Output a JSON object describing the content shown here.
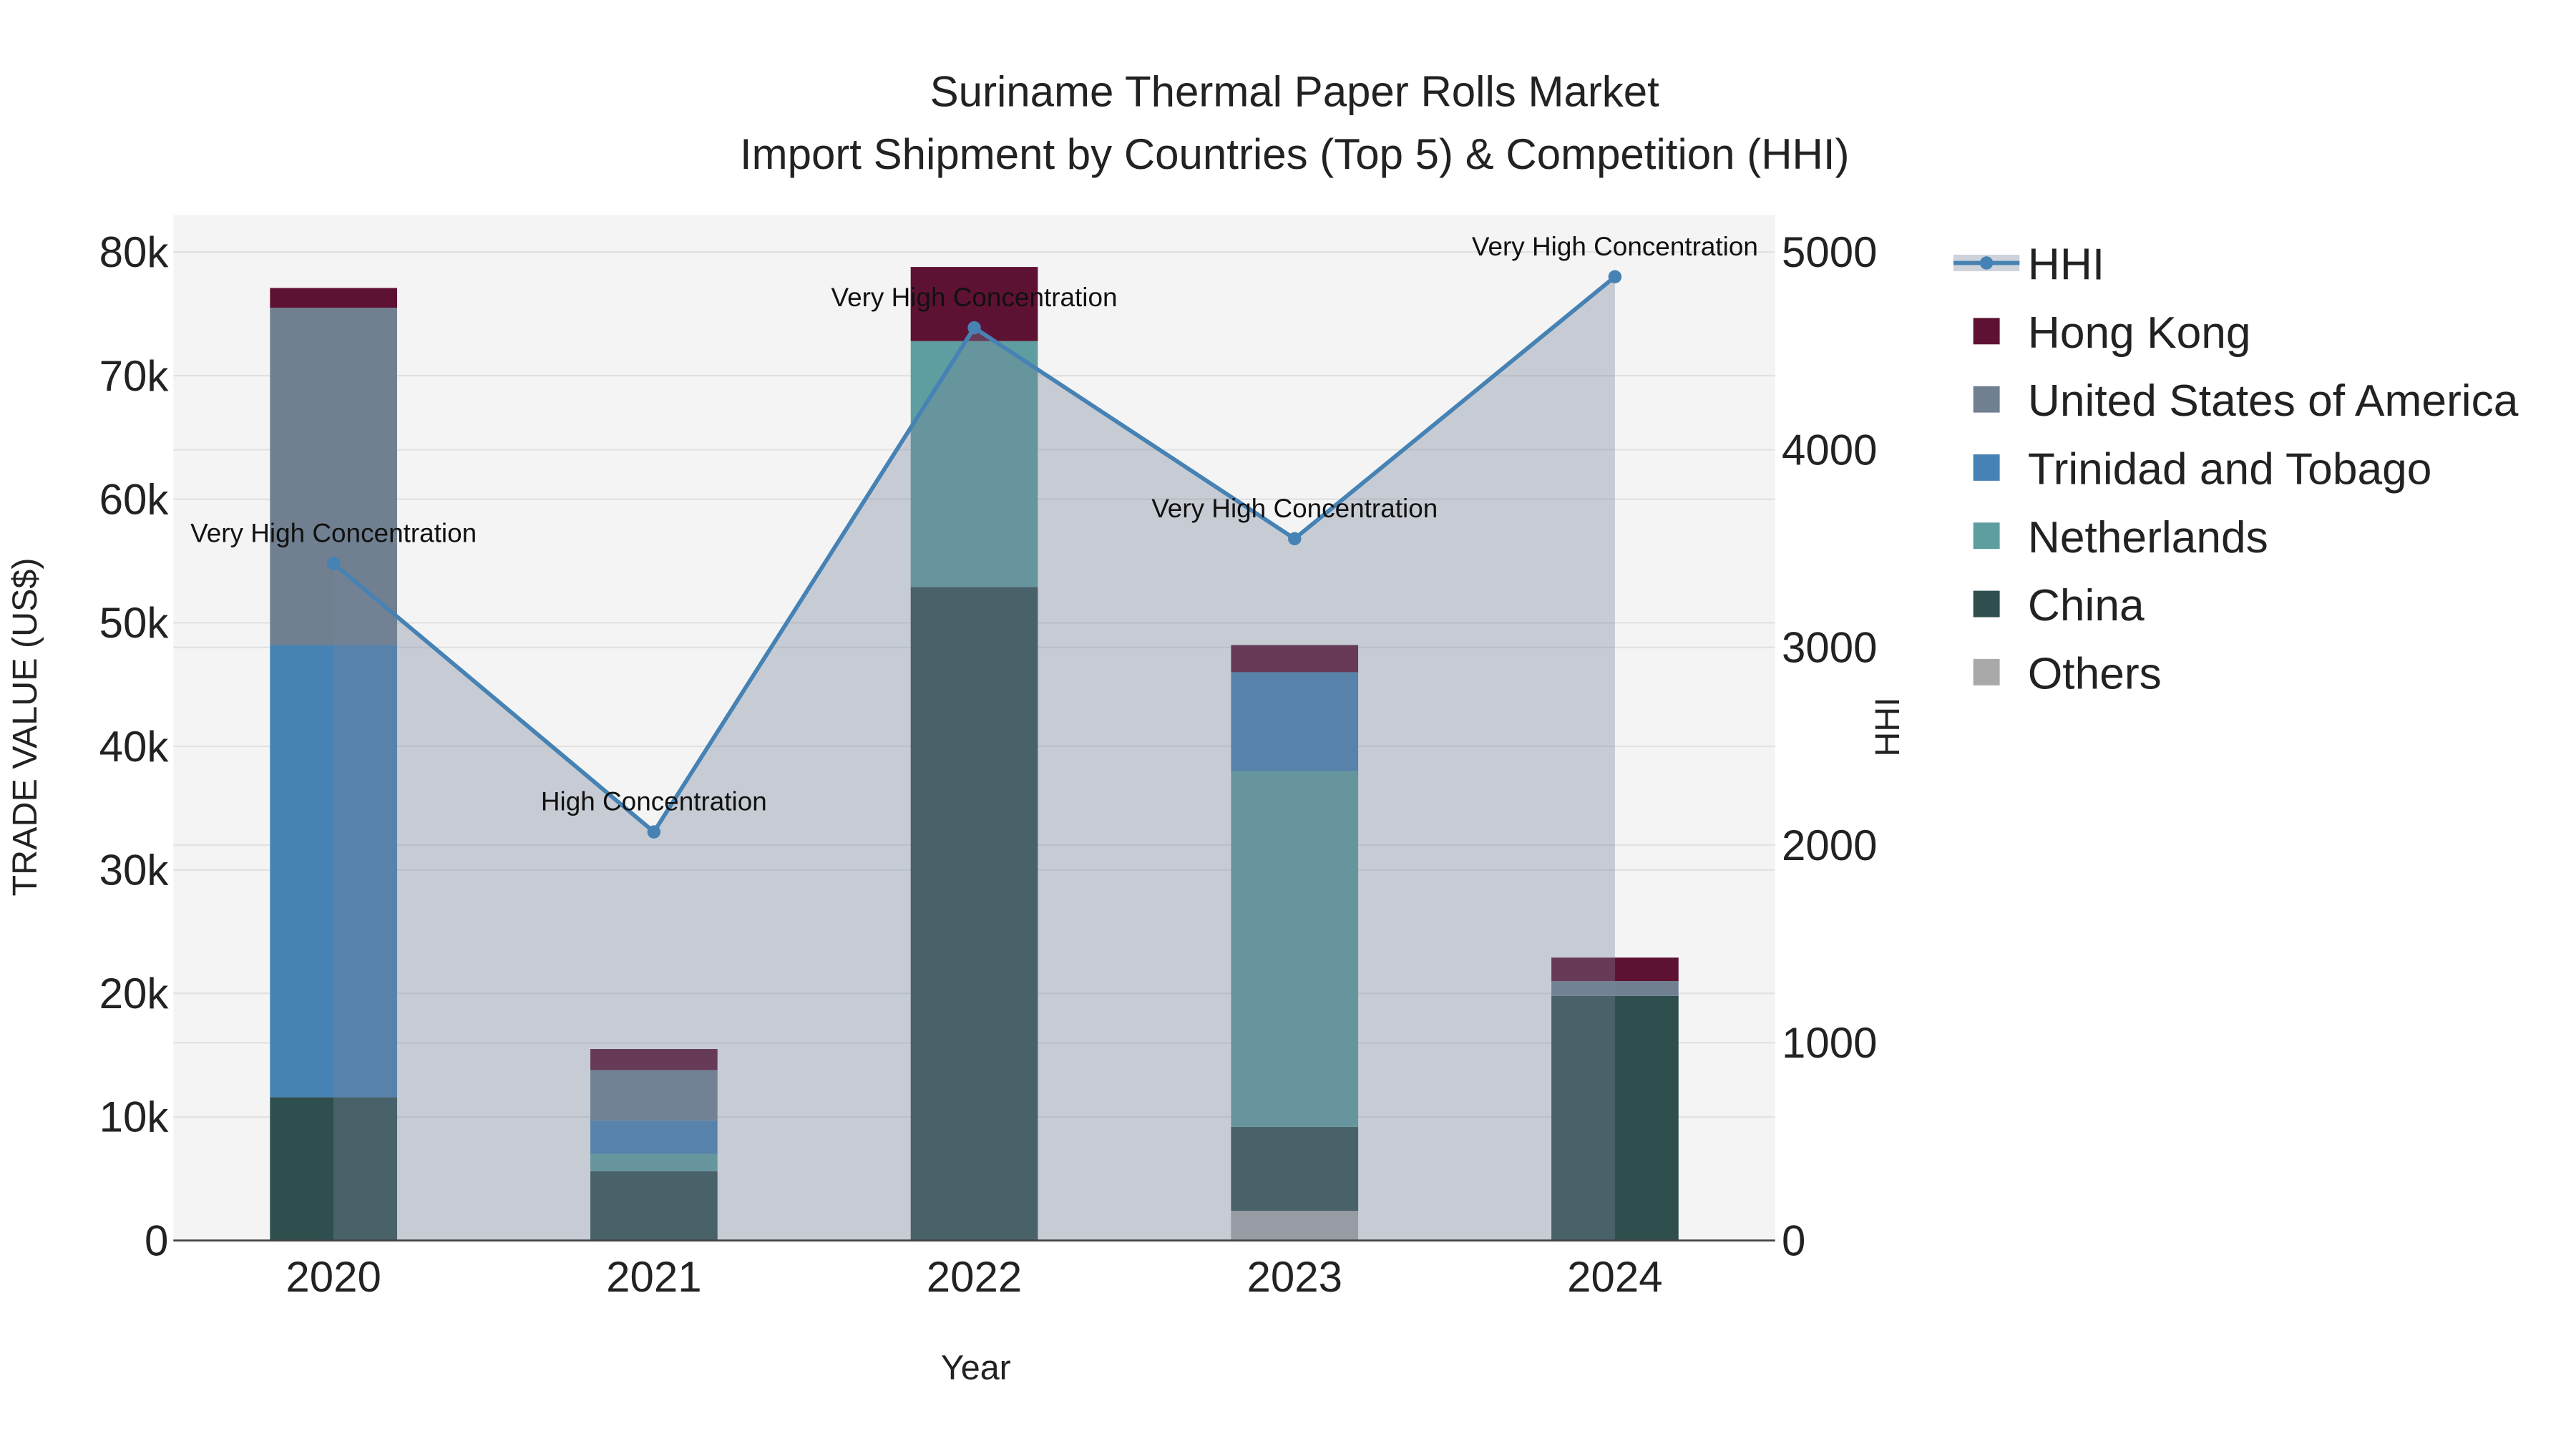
{
  "chart_data": {
    "type": "bar",
    "title": "Suriname Thermal Paper Rolls Market",
    "subtitle": "Import Shipment by Countries (Top 5) & Competition (HHI)",
    "xlabel": "Year",
    "ylabel": "TRADE VALUE (US$)",
    "y2label": "HHI",
    "categories": [
      "2020",
      "2021",
      "2022",
      "2023",
      "2024"
    ],
    "ylim": [
      0,
      83000
    ],
    "y2lim": [
      0,
      5187
    ],
    "yticks": [
      0,
      10000,
      20000,
      30000,
      40000,
      50000,
      60000,
      70000,
      80000
    ],
    "ytick_labels": [
      "0",
      "10k",
      "20k",
      "30k",
      "40k",
      "50k",
      "60k",
      "70k",
      "80k"
    ],
    "y2ticks": [
      0,
      1000,
      2000,
      3000,
      4000,
      5000
    ],
    "y2tick_labels": [
      "0",
      "1000",
      "2000",
      "3000",
      "4000",
      "5000"
    ],
    "stacked": true,
    "series": [
      {
        "name": "Others",
        "color": "#a9a9a9",
        "values": [
          0,
          0,
          0,
          2400,
          0
        ]
      },
      {
        "name": "China",
        "color": "#2f4f4f",
        "values": [
          11600,
          5600,
          52900,
          6800,
          19800
        ]
      },
      {
        "name": "Netherlands",
        "color": "#5f9ea0",
        "values": [
          0,
          1400,
          19900,
          28800,
          0
        ]
      },
      {
        "name": "Trinidad and Tobago",
        "color": "#4682b4",
        "values": [
          36600,
          2700,
          0,
          8000,
          0
        ]
      },
      {
        "name": "United States of America",
        "color": "#708090",
        "values": [
          27300,
          4100,
          0,
          0,
          1200
        ]
      },
      {
        "name": "Hong Kong",
        "color": "#5e1233",
        "values": [
          1600,
          1700,
          6000,
          2200,
          1900
        ]
      }
    ],
    "hhi": {
      "name": "HHI",
      "color": "#4682b4",
      "values": [
        3425,
        2067,
        4617,
        3550,
        4875
      ],
      "labels": [
        "Very High Concentration",
        "High Concentration",
        "Very High Concentration",
        "Very High Concentration",
        "Very High Concentration"
      ]
    },
    "legend": [
      "HHI",
      "Hong Kong",
      "United States of America",
      "Trinidad and Tobago",
      "Netherlands",
      "China",
      "Others"
    ],
    "legend_placement": "right",
    "grid": true
  }
}
